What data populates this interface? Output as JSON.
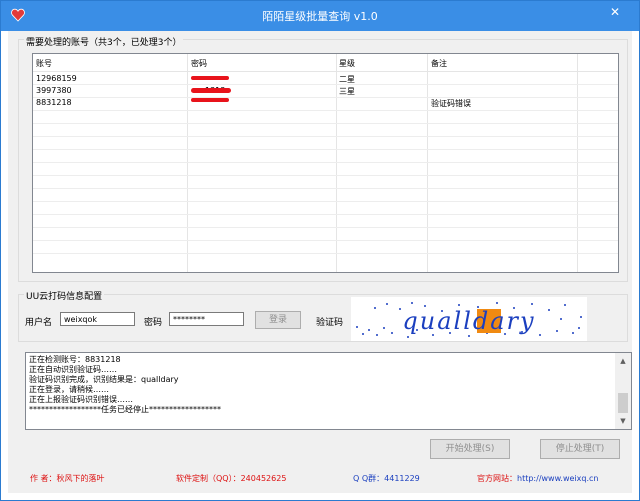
{
  "window": {
    "title": "陌陌星级批量查询 v1.0",
    "close_glyph": "✕"
  },
  "accounts": {
    "group_label": "需要处理的账号（共3个，已处理3个）",
    "columns": [
      "账号",
      "密码",
      "星级",
      "备注"
    ],
    "rows": [
      {
        "account": "12968159",
        "password": "",
        "stars": "二星",
        "note": ""
      },
      {
        "account": "3997380",
        "password": "1313",
        "stars": "三星",
        "note": ""
      },
      {
        "account": "8831218",
        "password": "",
        "stars": "",
        "note": "验证码错误"
      }
    ]
  },
  "captcha_config": {
    "group_label": "UU云打码信息配置",
    "username_label": "用户名",
    "username_value": "weixqok",
    "password_label": "密码",
    "password_value": "********",
    "login_button": "登录",
    "captcha_label": "验证码",
    "captcha_text": "qualldary"
  },
  "log": {
    "lines": [
      "正在检测账号：8831218",
      "正在自动识别验证码……",
      "验证码识别完成，识别结果是：qualldary",
      "正在登录，请稍候……",
      "正在上报验证码识别错误……",
      "******************任务已经停止******************"
    ]
  },
  "buttons": {
    "start": "开始处理(S)",
    "stop": "停止处理(T)"
  },
  "footer": {
    "author_label": "作 者：",
    "author_value": "秋风下的落叶",
    "custom_label": "软件定制（QQ）：",
    "custom_value": "240452625",
    "qqgroup_label": "Q Q群：",
    "qqgroup_value": "4411229",
    "site_label": "官方网站：",
    "site_value": "http://www.weixq.cn"
  },
  "colors": {
    "titlebar": "#3a8ee6",
    "footer_red": "#dd1111",
    "footer_blue": "#1a3fbf"
  }
}
